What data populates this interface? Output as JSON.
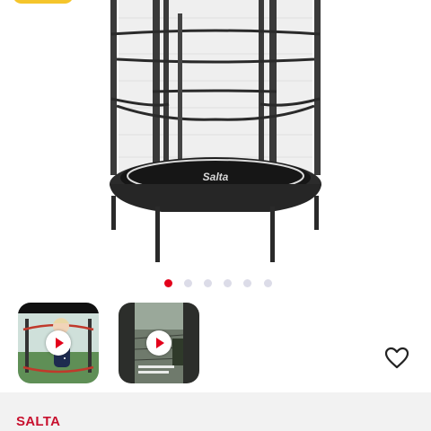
{
  "product": {
    "image_icon": "trampoline-with-safety-net",
    "logo_text_top": "Salta",
    "logo_text_front": "Salta"
  },
  "gallery": {
    "image_count": 6,
    "active_index": 0,
    "active_color": "#e3001b",
    "inactive_color": "#dcdce8"
  },
  "videos": [
    {
      "icon": "play-icon",
      "subject": "child-in-trampoline"
    },
    {
      "icon": "play-icon",
      "subject": "trampoline-net-closeup"
    }
  ],
  "wishlist": {
    "icon": "heart-outline-icon"
  },
  "brand": {
    "name": "SALTA",
    "color": "#c8102e"
  }
}
